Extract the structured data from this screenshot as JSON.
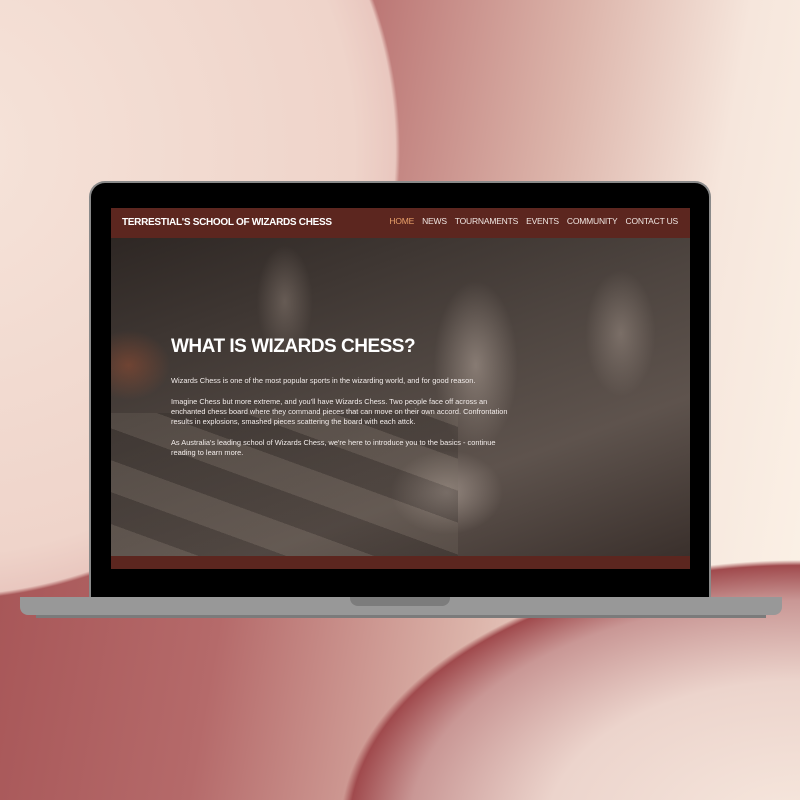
{
  "site": {
    "title": "TERRESTIAL'S SCHOOL OF WIZARDS CHESS",
    "nav": [
      {
        "label": "HOME",
        "active": true
      },
      {
        "label": "NEWS"
      },
      {
        "label": "TOURNAMENTS"
      },
      {
        "label": "EVENTS"
      },
      {
        "label": "COMMUNITY"
      },
      {
        "label": "CONTACT US"
      }
    ],
    "accent_color": "#e9a06a",
    "nav_color": "#5c261f"
  },
  "hero": {
    "heading": "WHAT IS WIZARDS CHESS?",
    "paragraphs": [
      "Wizards Chess is one of the most popular sports in the wizarding world, and for good reason.",
      "Imagine Chess but more extreme, and you'll have Wizards Chess. Two people face off across an enchanted chess board where they command pieces that can move on their own accord. Confrontation results in explosions, smashed pieces scattering the board with each attck.",
      "As Australia's leading school of Wizards Chess, we're here to introduce you to the basics - continue reading to learn more."
    ]
  }
}
